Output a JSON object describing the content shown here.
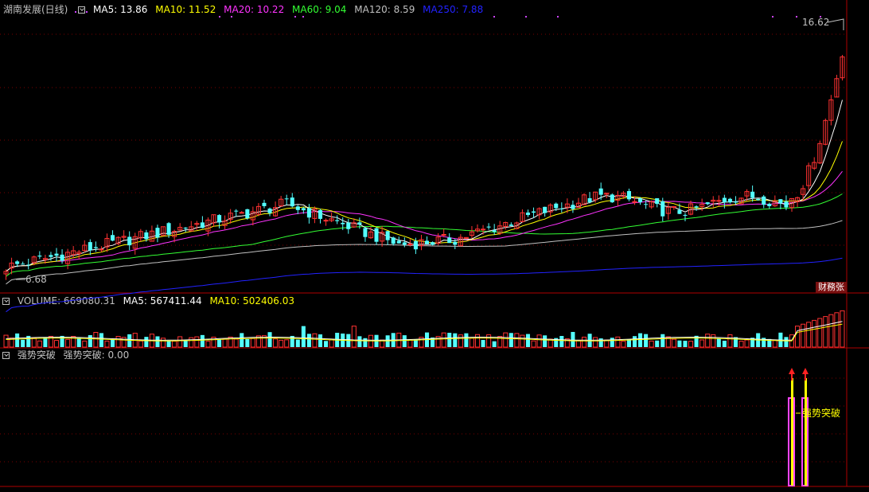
{
  "main": {
    "stock_title": "湖南发展(日线)",
    "ma5": {
      "label": "MA5: 13.86",
      "color": "#ffffff"
    },
    "ma10": {
      "label": "MA10: 11.52",
      "color": "#ffff00"
    },
    "ma20": {
      "label": "MA20: 10.22",
      "color": "#ff33ff"
    },
    "ma60": {
      "label": "MA60: 9.04",
      "color": "#33ff33"
    },
    "ma120": {
      "label": "MA120: 8.59",
      "color": "#c0c0c0"
    },
    "ma250": {
      "label": "MA250: 7.88",
      "color": "#2222ff"
    },
    "high_marker": "16.62",
    "low_marker": "6.68",
    "badge": "财務张"
  },
  "volume": {
    "vol_label": "VOLUME: 669080.31",
    "ma5_label": "MA5: 567411.44",
    "ma10_label": "MA10: 502406.03"
  },
  "signal": {
    "title": "强势突破",
    "value_label": "强势突破: 0.00",
    "signal_text": "强势突破"
  },
  "colors": {
    "up": "#ff3232",
    "down": "#54ffff",
    "grid": "#8b0000",
    "text": "#c0c0c0"
  },
  "chart_data": {
    "type": "candlestick",
    "price_range": [
      6.68,
      16.62
    ],
    "moving_averages": [
      "MA5",
      "MA10",
      "MA20",
      "MA60",
      "MA120",
      "MA250"
    ],
    "signal_count": 2
  }
}
